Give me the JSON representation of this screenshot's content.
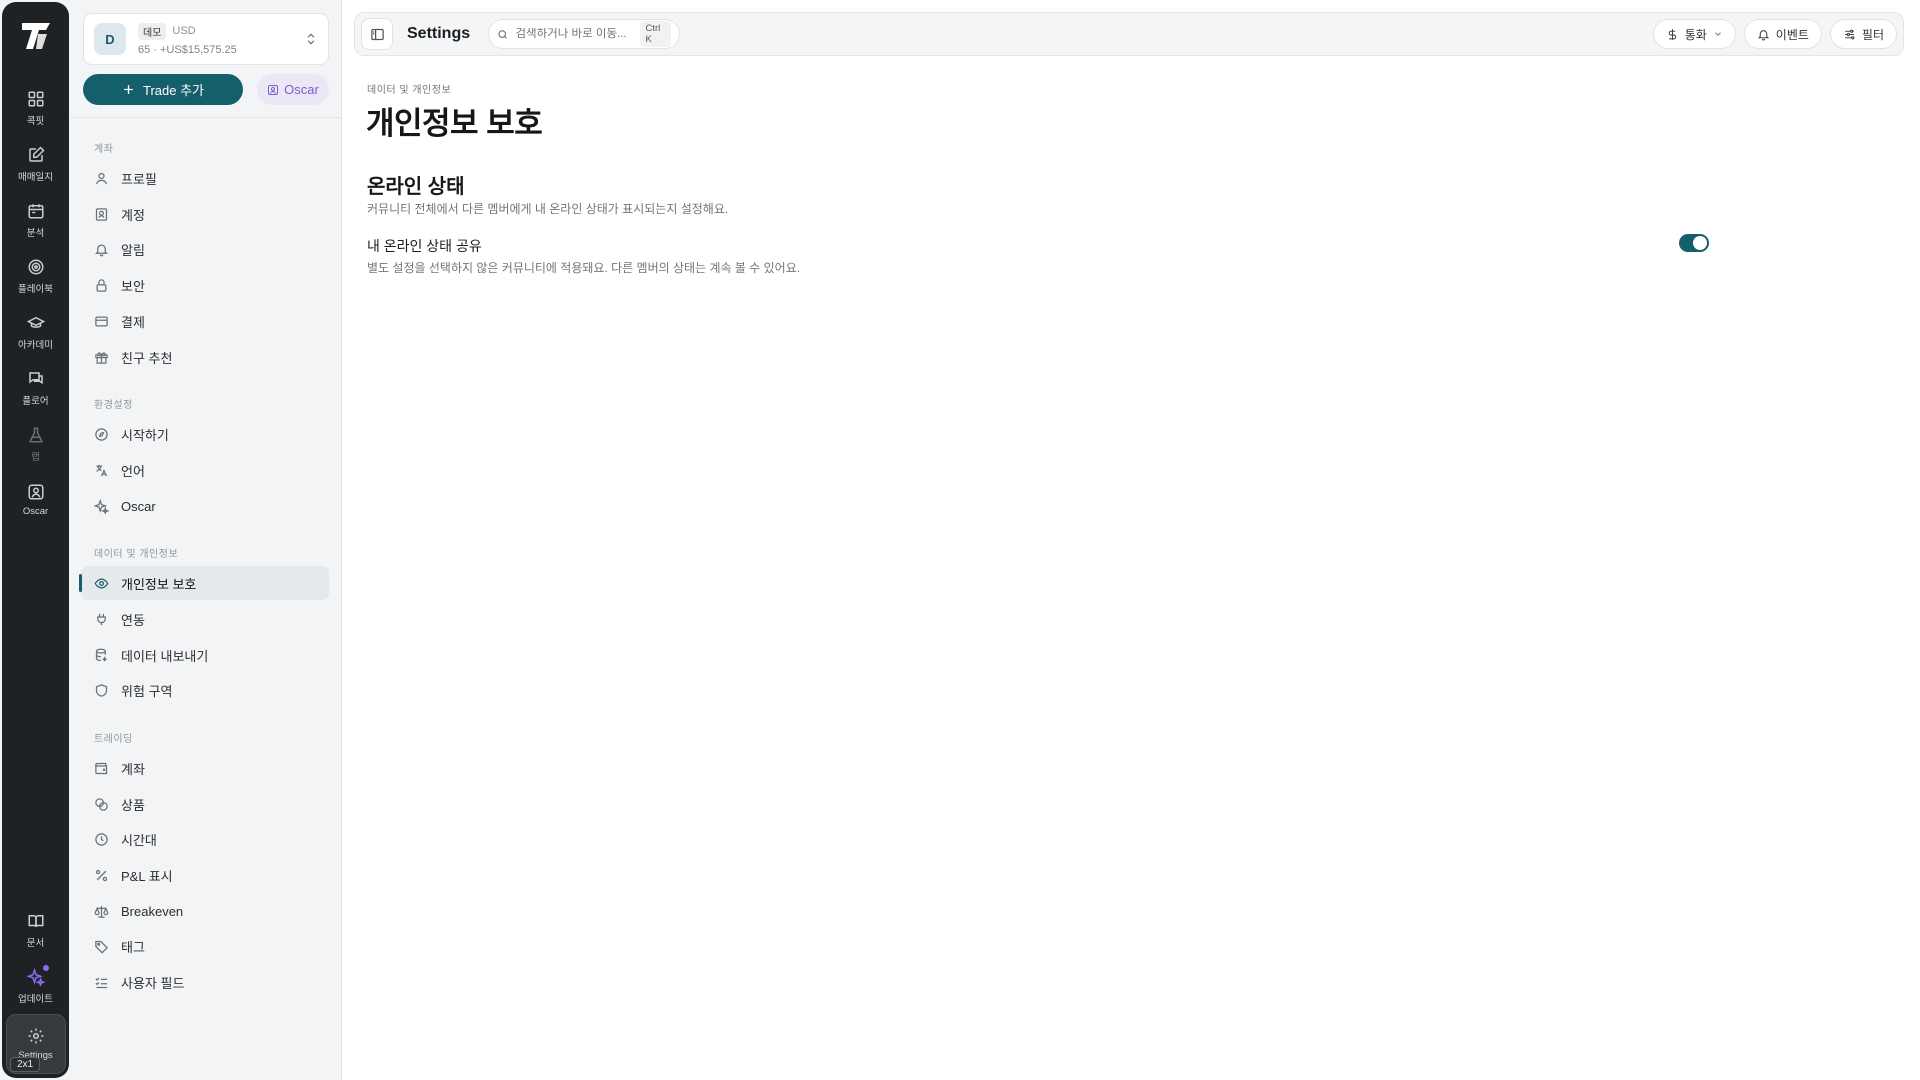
{
  "rail": {
    "items": [
      {
        "label": "콕핏",
        "icon": "grid-icon"
      },
      {
        "label": "매매일지",
        "icon": "journal-icon"
      },
      {
        "label": "분석",
        "icon": "calendar-icon"
      },
      {
        "label": "플레이북",
        "icon": "target-icon"
      },
      {
        "label": "아카데미",
        "icon": "graduation-icon"
      },
      {
        "label": "플로어",
        "icon": "chat-icon"
      },
      {
        "label": "랩",
        "icon": "flask-icon"
      },
      {
        "label": "Oscar",
        "icon": "oscar-icon"
      }
    ],
    "docs_label": "문서",
    "update_label": "업데이트",
    "settings_label": "Settings",
    "badge": "2x1"
  },
  "account": {
    "avatar": "D",
    "tag": "데모",
    "currency": "USD",
    "summary": "65 · +US$15,575.25"
  },
  "sidebar": {
    "add_trade_label": "Trade 추가",
    "oscar_label": "Oscar",
    "sections": {
      "account": "계좌",
      "prefs": "환경설정",
      "data": "데이터 및 개인정보",
      "trading": "트레이딩"
    },
    "account_items": [
      "프로필",
      "계정",
      "알림",
      "보안",
      "결제",
      "친구 추천"
    ],
    "prefs_items": [
      "시작하기",
      "언어",
      "Oscar"
    ],
    "data_items": [
      "개인정보 보호",
      "연동",
      "데이터 내보내기",
      "위험 구역"
    ],
    "trading_items": [
      "계좌",
      "상품",
      "시간대",
      "P&L 표시",
      "Breakeven",
      "태그",
      "사용자 필드"
    ]
  },
  "topbar": {
    "title": "Settings",
    "search_placeholder": "검색하거나 바로 이동...",
    "shortcut": "Ctrl K",
    "currency_label": "통화",
    "events_label": "이벤트",
    "filter_label": "필터"
  },
  "page": {
    "breadcrumb": "데이터 및 개인정보",
    "title": "개인정보 보호",
    "section_title": "온라인 상태",
    "section_desc": "커뮤니티 전체에서 다른 멤버에게 내 온라인 상태가 표시되는지 설정해요.",
    "setting_label": "내 온라인 상태 공유",
    "setting_desc": "별도 설정을 선택하지 않은 커뮤니티에 적용돼요. 다른 멤버의 상태는 계속 볼 수 있어요.",
    "toggle_on": true
  },
  "colors": {
    "accent": "#155e6b",
    "oscar": "#7a5fd0",
    "rail_bg": "#1f2225"
  }
}
